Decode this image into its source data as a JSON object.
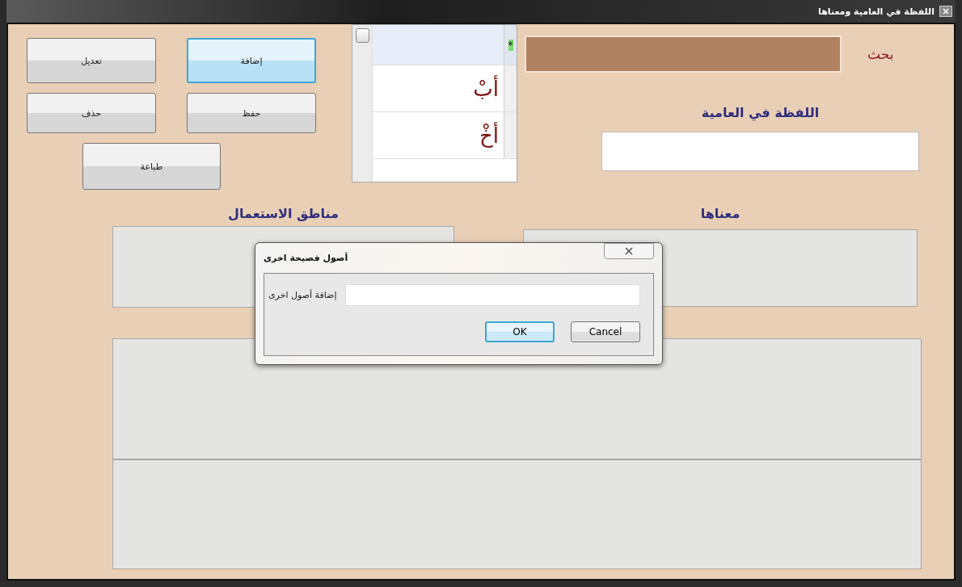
{
  "window": {
    "title": "اللفظة في العامية ومعناها"
  },
  "buttons": [
    {
      "label": "تعديل",
      "focused": false
    },
    {
      "label": "إضافة",
      "focused": true
    },
    {
      "label": "حذف",
      "focused": false
    },
    {
      "label": "حفظ",
      "focused": false
    },
    {
      "label": "طباعة",
      "focused": false
    }
  ],
  "word_list": {
    "rows": [
      {
        "kind": "new-row",
        "marker": "*",
        "selected": true
      },
      {
        "kind": "entry",
        "word": "أبْ",
        "selected": false
      },
      {
        "kind": "entry",
        "word": "أخْ",
        "selected": false
      }
    ]
  },
  "search": {
    "label": "بحث"
  },
  "word_field": {
    "label": "اللفظة في العامية"
  },
  "usage_regions": {
    "label": "مناطق الاستعمال"
  },
  "meaning": {
    "label": "معناها"
  },
  "dialog": {
    "title": "أصول فصيحة اخرى",
    "field_label": "إضافة أصول اخرى",
    "buttons": [
      {
        "label": "Cancel",
        "default": false
      },
      {
        "label": "OK",
        "default": true
      }
    ]
  }
}
